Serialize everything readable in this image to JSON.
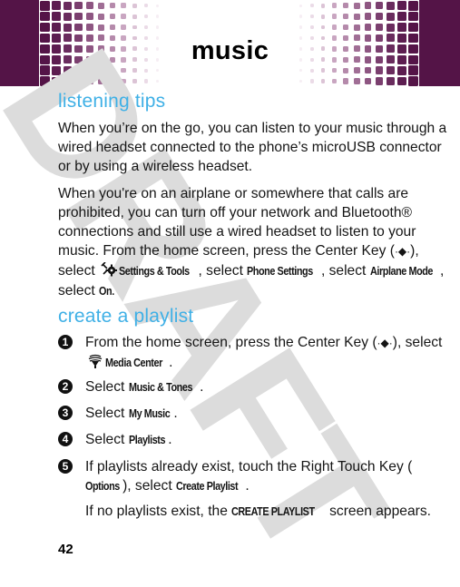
{
  "header": {
    "title": "music",
    "brand_color": "#541447",
    "dot_colors": [
      "#541447",
      "#5c1d50",
      "#6a2c5e",
      "#7b3f6f",
      "#8e5682",
      "#a06e95",
      "#b58aab",
      "#c9a6c1",
      "#dcc4d6",
      "#ebdbe7",
      "#f6eef4"
    ]
  },
  "watermark": {
    "text": "DRAFT"
  },
  "sections": {
    "listening_tips": {
      "title": "listening tips",
      "para1": "When you’re on the go, you can listen to your music through a wired headset connected to the phone’s microUSB connector or by using a wireless headset.",
      "para2": {
        "part1": "When you're on an airplane or somewhere that calls are prohibited, you can turn off your network and Bluetooth® connections and still use a wired headset to listen to your music. From the home screen, press the Center Key (",
        "center_key_glyph": "·◆·",
        "part2": "), select",
        "settings_icon": "settings-tools-icon",
        "settings_label": "Settings & Tools",
        "part3": ", select",
        "phone_settings": "Phone Settings",
        "part4": ", select",
        "airplane_mode": "Airplane Mode",
        "part5": ", select",
        "on": "On",
        "part6": "."
      }
    },
    "create_playlist": {
      "title": "create a playlist",
      "steps": [
        {
          "num": "1",
          "part1": "From the home screen, press the Center Key (",
          "center_key_glyph": "·◆·",
          "part2": "), select",
          "icon": "media-center-icon",
          "label": "Media Center",
          "end": "."
        },
        {
          "num": "2",
          "prefix": "Select",
          "label": "Music & Tones",
          "end": "."
        },
        {
          "num": "3",
          "prefix": "Select",
          "label": "My Music",
          "end": "."
        },
        {
          "num": "4",
          "prefix": "Select",
          "label": "Playlists",
          "end": "."
        },
        {
          "num": "5",
          "part1": "If playlists already exist, touch the Right Touch Key (",
          "options": "Options",
          "part2": "), select",
          "label": "Create Playlist",
          "end": "."
        }
      ],
      "note": {
        "part1": "If no playlists exist, the",
        "screen_name": "CREATE PLAYLIST",
        "part2": "screen appears."
      }
    }
  },
  "footer": {
    "page_number": "42"
  }
}
